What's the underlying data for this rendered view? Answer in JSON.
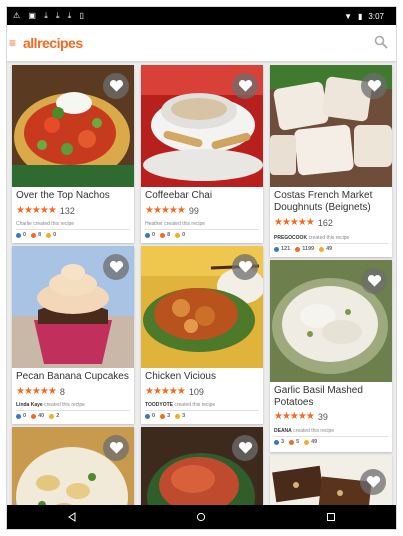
{
  "status_bar": {
    "left_icons": [
      "alert-icon",
      "photo-icon",
      "download-icon",
      "download-icon",
      "download-icon",
      "phone-icon"
    ],
    "time": "3:07"
  },
  "app_bar": {
    "logo_text": "allrecipes",
    "accent_color": "#f46a1f"
  },
  "recipes": [
    {
      "title": "Over the Top Nachos",
      "stars": "★★★★★",
      "rating_count": "132",
      "creator_name": "Charlie",
      "created_text": "created this recipe",
      "stats": {
        "made": "0",
        "favorites": "8",
        "reviews": "0"
      }
    },
    {
      "title": "Coffeebar Chai",
      "stars": "★★★★★",
      "rating_count": "99",
      "creator_name": "Heather",
      "created_text": "created this recipe",
      "stats": {
        "made": "0",
        "favorites": "8",
        "reviews": "0"
      }
    },
    {
      "title": "Costas French Market Doughnuts (Beignets)",
      "stars": "★★★★★",
      "rating_count": "162",
      "creator_name": "PREGOCOOK",
      "created_text": "created this recipe",
      "stats": {
        "made": "121",
        "favorites": "1199",
        "reviews": "49"
      }
    },
    {
      "title": "Pecan Banana Cupcakes",
      "stars": "★★★★★",
      "rating_count": "8",
      "creator_name": "Linda Kaye",
      "created_text": "created this recipe",
      "stats": {
        "made": "0",
        "favorites": "40",
        "reviews": "2"
      }
    },
    {
      "title": "Chicken Vicious",
      "stars": "★★★★★",
      "rating_count": "109",
      "creator_name": "TOODYOTE",
      "created_text": "created this recipe",
      "stats": {
        "made": "0",
        "favorites": "3",
        "reviews": "3"
      }
    },
    {
      "title": "Garlic Basil Mashed Potatoes",
      "stars": "★★★★★",
      "rating_count": "39",
      "creator_name": "DEANA",
      "created_text": "created this recipe",
      "stats": {
        "made": "3",
        "favorites": "5",
        "reviews": "49"
      }
    }
  ],
  "bottom_nav": [
    "back-icon",
    "home-icon",
    "recents-icon"
  ]
}
